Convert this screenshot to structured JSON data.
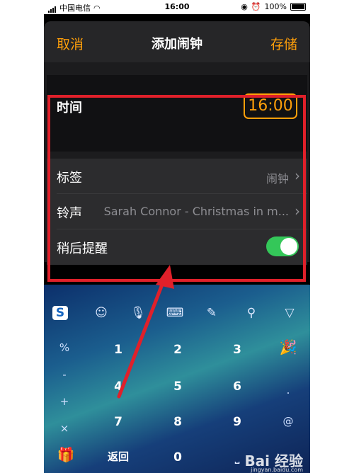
{
  "status_bar": {
    "carrier": "中国电信",
    "time": "16:00",
    "battery": "100%"
  },
  "nav": {
    "cancel_label": "取消",
    "title": "添加闹钟",
    "save_label": "存储"
  },
  "time_row": {
    "label": "时间",
    "value": "16:00"
  },
  "settings": [
    {
      "label": "标签",
      "value": "闹钟"
    },
    {
      "label": "铃声",
      "value": "Sarah Connor - Christmas in m..."
    },
    {
      "label": "稍后提醒",
      "toggle": true
    }
  ],
  "keyboard": {
    "toolbar_icons": [
      "sogou-logo-icon",
      "emoji-icon",
      "mic-icon",
      "keyboard-icon",
      "handwriting-icon",
      "search-icon",
      "collapse-icon"
    ],
    "left_symbols": [
      "%",
      "-",
      "+",
      "×"
    ],
    "numbers": [
      [
        "1",
        "2",
        "3"
      ],
      [
        "4",
        "5",
        "6"
      ],
      [
        "7",
        "8",
        "9"
      ],
      [
        "0"
      ]
    ],
    "right_symbols": [
      ".",
      "@"
    ],
    "return_label": "返回"
  },
  "watermark": {
    "text": "Bai 经验",
    "sub": "jingyan.baidu.com"
  },
  "colors": {
    "accent": "#ff9f0a",
    "toggle_on": "#34c759",
    "highlight_box": "#e0202a"
  }
}
